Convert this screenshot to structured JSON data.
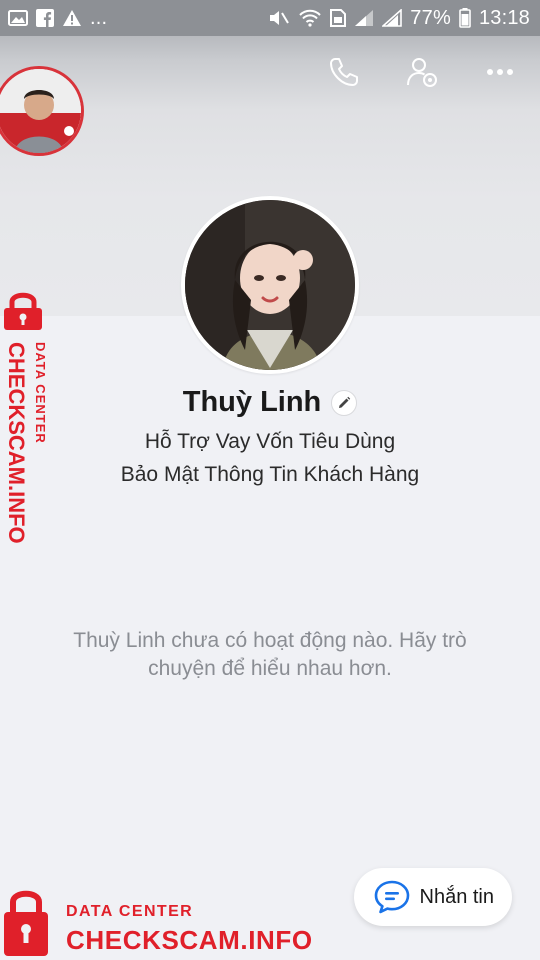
{
  "status_bar": {
    "battery": "77%",
    "time": "13:18",
    "overflow": "..."
  },
  "profile": {
    "name": "Thuỳ Linh",
    "bio_line1": "Hỗ Trợ Vay Vốn Tiêu Dùng",
    "bio_line2": "Bảo Mật Thông Tin Khách Hàng"
  },
  "empty_state": {
    "message": "Thuỳ Linh chưa có hoạt động nào. Hãy trò chuyện để hiểu nhau hơn."
  },
  "actions": {
    "message_label": "Nhắn tin"
  },
  "watermark": {
    "line1": "DATA CENTER",
    "line2": "CHECKSCAM.INFO"
  },
  "colors": {
    "accent_blue": "#1a73e8",
    "watermark_red": "#e0202a"
  },
  "icons": {
    "top_bar": [
      "phone-icon",
      "user-settings-icon",
      "more-icon"
    ],
    "message_button": "chat-bubble-icon"
  }
}
